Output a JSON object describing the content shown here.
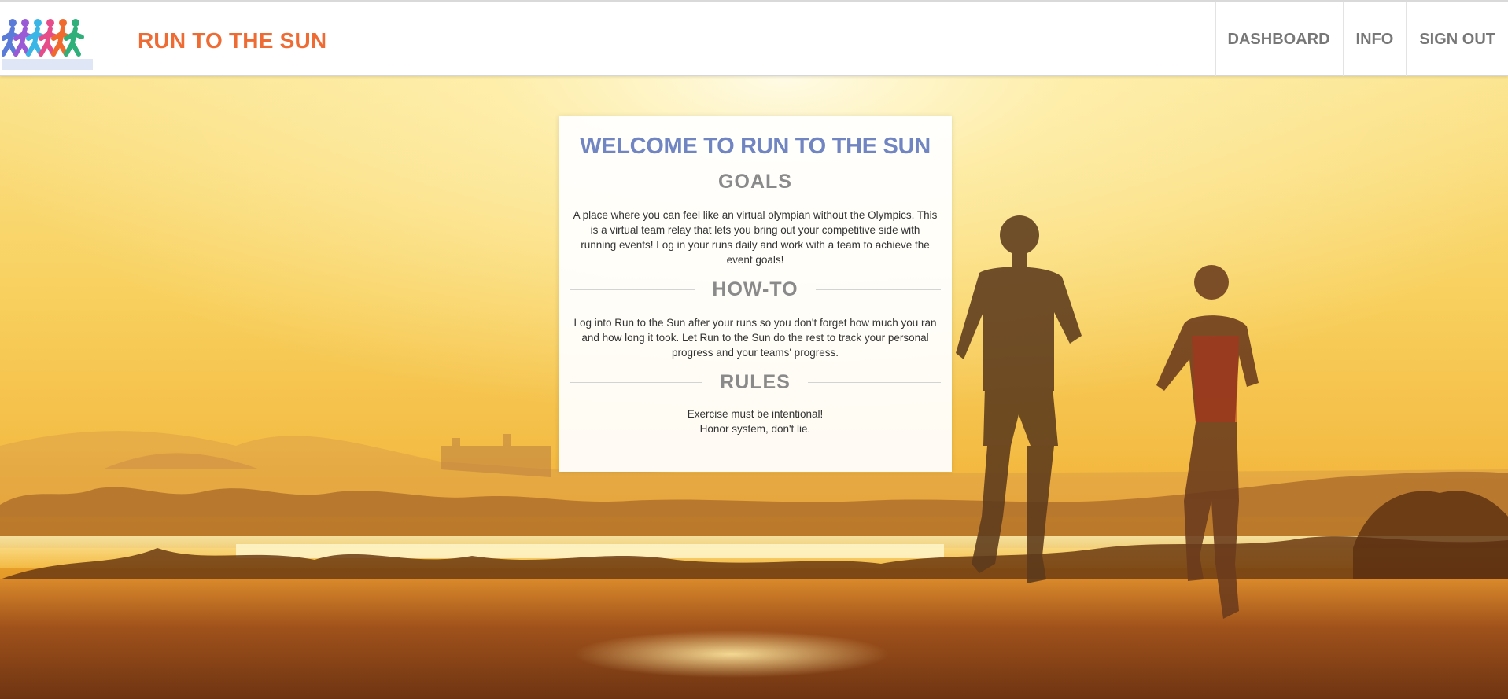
{
  "header": {
    "brand": "RUN TO THE SUN",
    "logo_icon": "runners-logo-icon",
    "nav": [
      {
        "label": "DASHBOARD"
      },
      {
        "label": "INFO"
      },
      {
        "label": "SIGN OUT"
      }
    ]
  },
  "welcome": {
    "title": "WELCOME TO RUN TO THE SUN",
    "goals": {
      "heading": "GOALS",
      "text": "A place where you can feel like an virtual olympian without the Olympics. This is a virtual team relay that lets you bring out your competitive side with running events! Log in your runs daily and work with a team to achieve the event goals!"
    },
    "howto": {
      "heading": "HOW-TO",
      "text": "Log into Run to the Sun after your runs so you don't forget how much you ran and how long it took. Let Run to the Sun do the rest to track your personal progress and your teams' progress."
    },
    "rules": {
      "heading": "RULES",
      "items": [
        "Exercise must be intentional!",
        "Honor system, don't lie."
      ]
    }
  },
  "colors": {
    "brand": "#ef6b34",
    "title": "#7085c2",
    "nav_text": "#777777",
    "heading_gray": "#8a8a8a"
  }
}
